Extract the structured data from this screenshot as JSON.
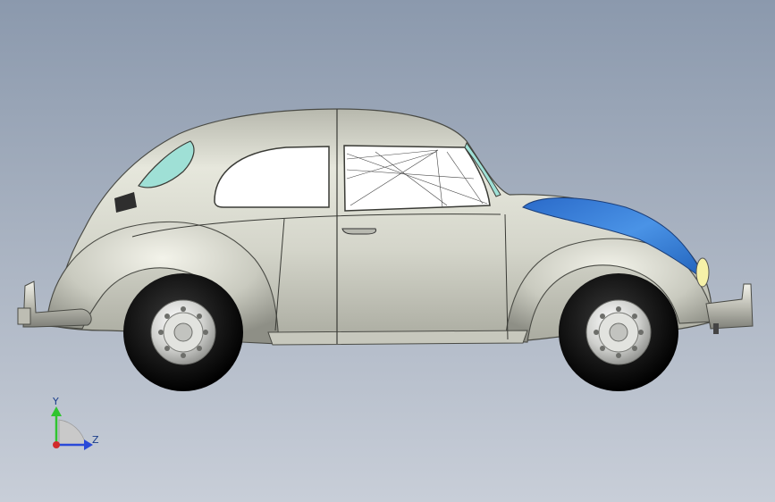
{
  "viewport": {
    "background_top": "#8b99ad",
    "background_bottom": "#c8ced8"
  },
  "model": {
    "body_color": "#d9dacf",
    "window_tint": "#9fe0d6",
    "accent_panel": "#2e7bd6",
    "tire_color": "#151515",
    "hubcap_color": "#d7d8d6"
  },
  "triad": {
    "y_label": "Y",
    "z_label": "Z",
    "y_color": "#2fc42f",
    "z_color": "#2a49d8",
    "x_color": "#d12a2a"
  }
}
